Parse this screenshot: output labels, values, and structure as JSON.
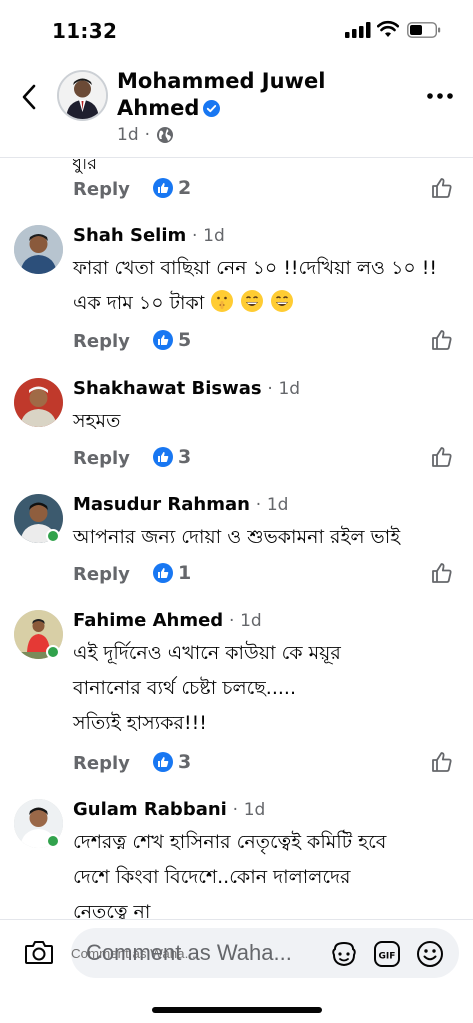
{
  "status_bar": {
    "time": "11:32"
  },
  "header": {
    "name": "Mohammed Juwel Ahmed",
    "meta_time": "1d",
    "meta_separator": "·"
  },
  "feed": {
    "cut_text": "ধুরি",
    "top_actions": {
      "reply": "Reply",
      "likes": "2"
    },
    "comments": [
      {
        "name": "Shah Selim",
        "time": "1d",
        "text": "ফারা খেতা বাছিয়া নেন ১০ !!দেখিয়া লও ১০ !!এক দাম ১০ টাকা",
        "emojis": [
          "shushing-face-emoji",
          "grinning-face-emoji",
          "grinning-face-emoji"
        ],
        "reply": "Reply",
        "likes": "5",
        "online": false
      },
      {
        "name": "Shakhawat Biswas",
        "time": "1d",
        "text": "সহমত",
        "reply": "Reply",
        "likes": "3",
        "online": false
      },
      {
        "name": "Masudur Rahman",
        "time": "1d",
        "text": "আপনার জন্য দোয়া ও শুভকামনা রইল ভাই",
        "reply": "Reply",
        "likes": "1",
        "online": true
      },
      {
        "name": "Fahime Ahmed",
        "time": "1d",
        "text_lines": [
          "এই দূর্দিনেও এখানে কাউয়া কে ময়ূর",
          "বানানোর ব্যর্থ চেষ্টা চলছে.....",
          "সত্যিই হাস্যকর!!!"
        ],
        "reply": "Reply",
        "likes": "3",
        "online": true
      },
      {
        "name": "Gulam Rabbani",
        "time": "1d",
        "text_lines": [
          "দেশরত্ন শেখ হাসিনার নেতৃত্বেই কমিটি হবে",
          "দেশে কিংবা বিদেশে..কোন দালালদের",
          "নেতৃত্বে না"
        ],
        "online": true
      }
    ]
  },
  "comment_bar": {
    "placeholder": "Comment as Waha..."
  },
  "colors": {
    "facebook_blue": "#1877f2",
    "meta_gray": "#65676b",
    "online_green": "#31a24c"
  }
}
